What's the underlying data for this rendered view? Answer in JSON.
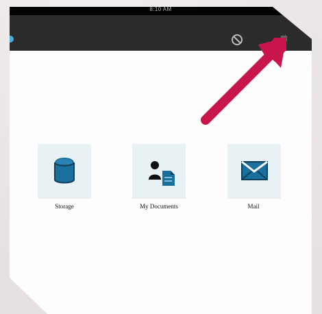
{
  "status_bar": {
    "time": "8:10 AM"
  },
  "toolbar": {
    "icons": [
      "settings-icon",
      "sync-icon"
    ]
  },
  "apps": [
    {
      "label": "Storage",
      "icon": "database-icon"
    },
    {
      "label": "My Documents",
      "icon": "user-document-icon"
    },
    {
      "label": "Mail",
      "icon": "mail-icon"
    }
  ],
  "colors": {
    "toolbar_bg": "#2b2b2b",
    "tile_bg": "#e8f2f5",
    "icon_blue": "#1a6f9c",
    "arrow_color": "#c8164d"
  }
}
